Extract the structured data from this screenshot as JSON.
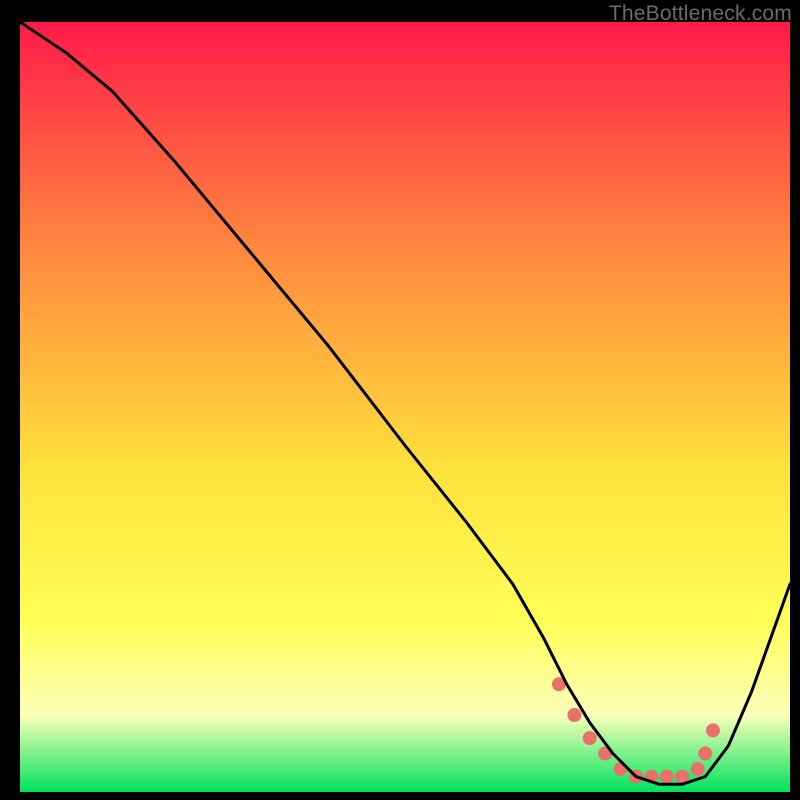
{
  "watermark": "TheBottleneck.com",
  "colors": {
    "gradient_top": "#ff1a49",
    "gradient_mid1": "#ff833f",
    "gradient_mid2": "#ffe23c",
    "gradient_mid3": "#ffff58",
    "gradient_mid4": "#fbffb9",
    "gradient_bottom": "#00e25e",
    "curve": "#000000",
    "markers": "#e8716c"
  },
  "chart_data": {
    "type": "line",
    "title": "",
    "xlabel": "",
    "ylabel": "",
    "xlim": [
      0,
      100
    ],
    "ylim": [
      0,
      100
    ],
    "series": [
      {
        "name": "bottleneck-curve",
        "x": [
          0,
          6,
          12,
          20,
          30,
          40,
          50,
          58,
          64,
          68,
          71,
          74,
          77,
          80,
          83,
          86,
          89,
          92,
          95,
          100
        ],
        "y": [
          100,
          96,
          91,
          82,
          70,
          58,
          45,
          35,
          27,
          20,
          14,
          9,
          5,
          2,
          1,
          1,
          2,
          6,
          13,
          27
        ]
      }
    ],
    "markers": {
      "name": "highlight-dots",
      "x": [
        70,
        72,
        74,
        76,
        78,
        80,
        82,
        84,
        86,
        88,
        89,
        90
      ],
      "y": [
        14,
        10,
        7,
        5,
        3,
        2,
        2,
        2,
        2,
        3,
        5,
        8
      ]
    }
  }
}
